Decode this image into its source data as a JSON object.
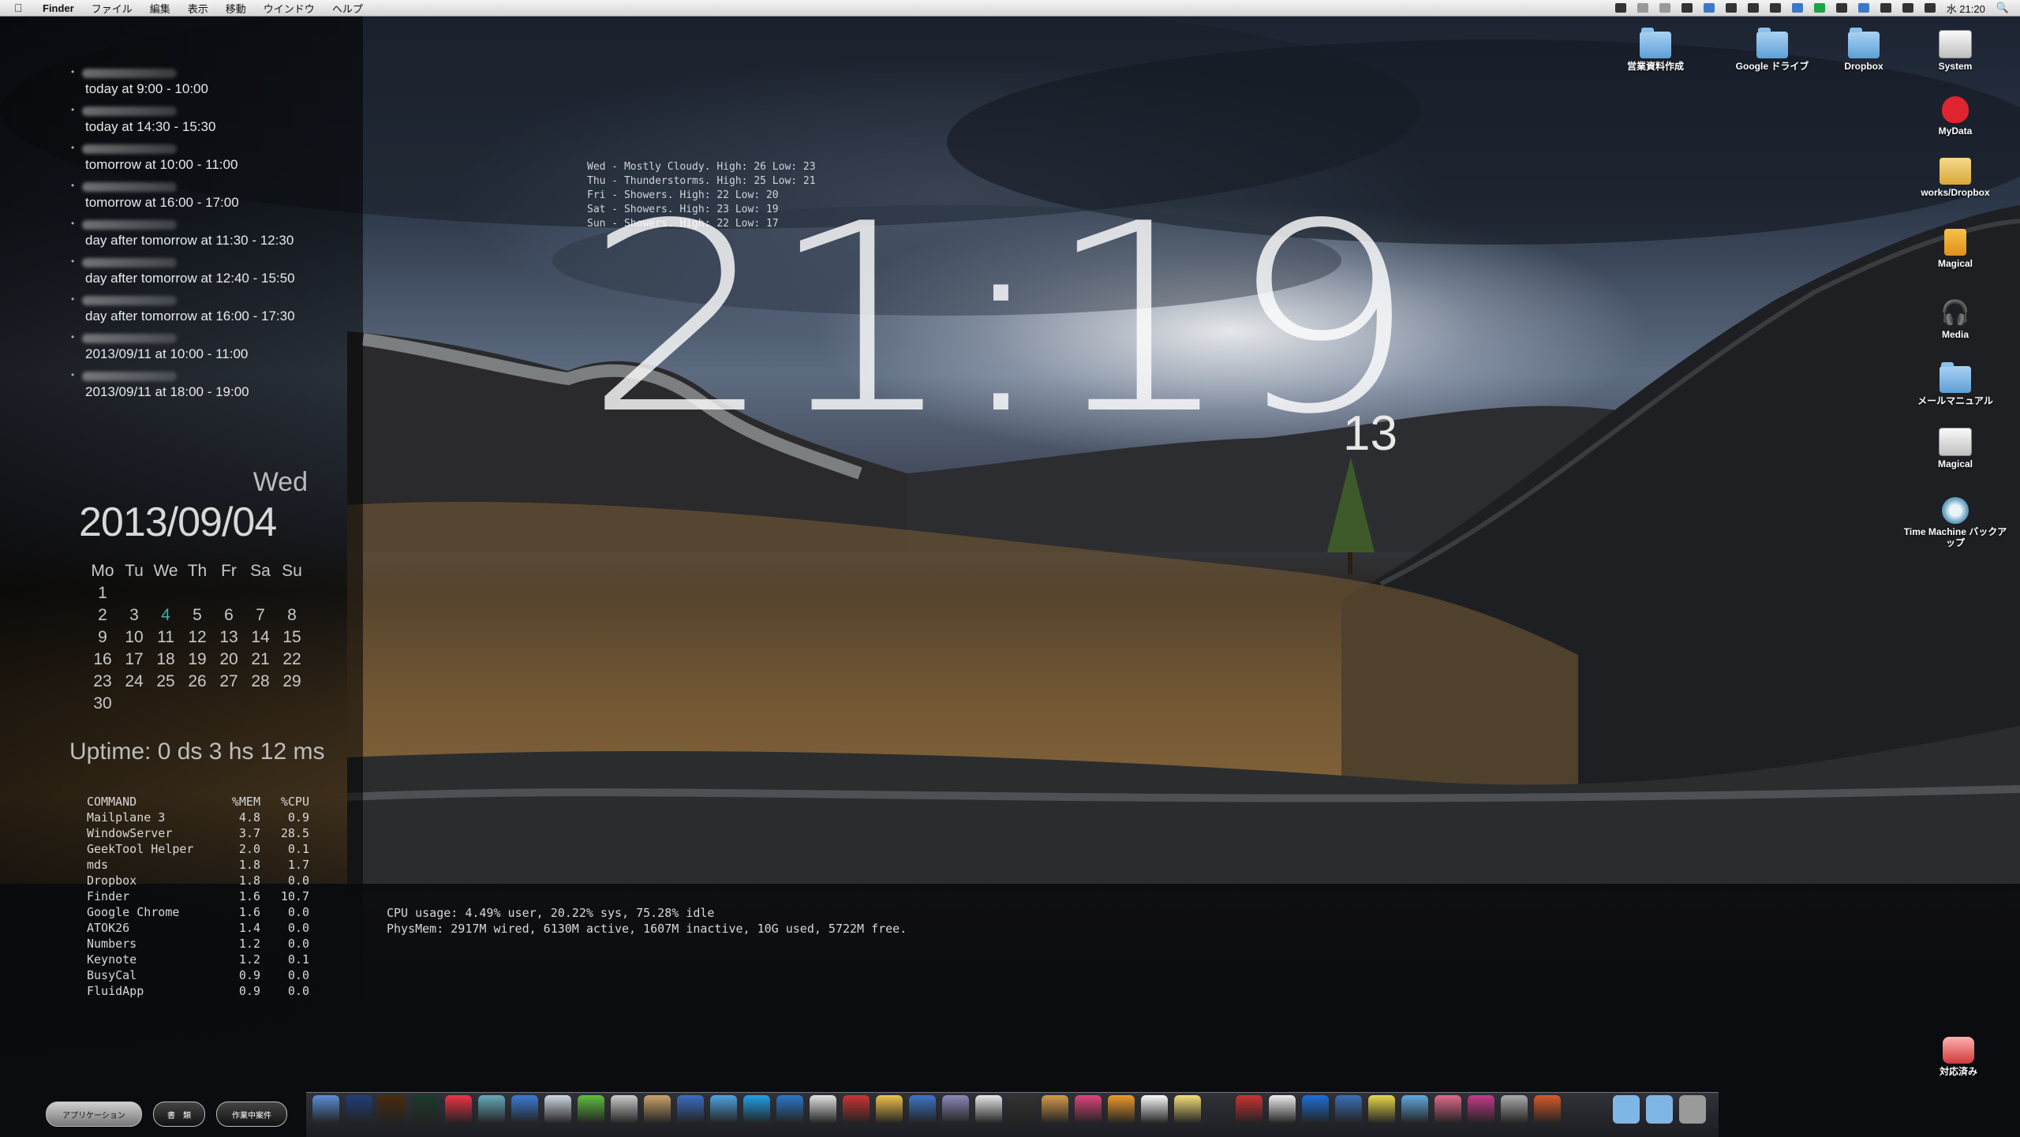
{
  "menubar": {
    "items": [
      "Finder",
      "ファイル",
      "編集",
      "表示",
      "移動",
      "ウインドウ",
      "ヘルプ"
    ],
    "time": "水 21:20"
  },
  "events": [
    {
      "time": "today at 9:00 - 10:00"
    },
    {
      "time": "today at 14:30 - 15:30"
    },
    {
      "time": "tomorrow at 10:00 - 11:00"
    },
    {
      "time": "tomorrow at 16:00 - 17:00"
    },
    {
      "time": "day after tomorrow at 11:30 - 12:30"
    },
    {
      "time": "day after tomorrow at 12:40 - 15:50"
    },
    {
      "time": "day after tomorrow at 16:00 - 17:30"
    },
    {
      "time": "2013/09/11 at 10:00 - 11:00"
    },
    {
      "time": "2013/09/11 at 18:00 - 19:00"
    }
  ],
  "date": {
    "weekday": "Wed",
    "full": "2013/09/04"
  },
  "calendar": {
    "header": [
      "Mo",
      "Tu",
      "We",
      "Th",
      "Fr",
      "Sa",
      "Su"
    ],
    "weeks": [
      [
        "1",
        "",
        "",
        "",
        "",
        "",
        ""
      ],
      [
        "2",
        "3",
        "4",
        "5",
        "6",
        "7",
        "8"
      ],
      [
        "9",
        "10",
        "11",
        "12",
        "13",
        "14",
        "15"
      ],
      [
        "16",
        "17",
        "18",
        "19",
        "20",
        "21",
        "22"
      ],
      [
        "23",
        "24",
        "25",
        "26",
        "27",
        "28",
        "29"
      ],
      [
        "30",
        "",
        "",
        "",
        "",
        "",
        ""
      ]
    ],
    "today": "4"
  },
  "uptime": "Uptime: 0 ds 3 hs 12 ms",
  "processes": {
    "header": {
      "name": "COMMAND",
      "mem": "%MEM",
      "cpu": "%CPU"
    },
    "rows": [
      {
        "name": "Mailplane 3",
        "mem": "4.8",
        "cpu": "0.9"
      },
      {
        "name": "WindowServer",
        "mem": "3.7",
        "cpu": "28.5"
      },
      {
        "name": "GeekTool Helper",
        "mem": "2.0",
        "cpu": "0.1"
      },
      {
        "name": "mds",
        "mem": "1.8",
        "cpu": "1.7"
      },
      {
        "name": "Dropbox",
        "mem": "1.8",
        "cpu": "0.0"
      },
      {
        "name": "Finder",
        "mem": "1.6",
        "cpu": "10.7"
      },
      {
        "name": "Google Chrome",
        "mem": "1.6",
        "cpu": "0.0"
      },
      {
        "name": "ATOK26",
        "mem": "1.4",
        "cpu": "0.0"
      },
      {
        "name": "Numbers",
        "mem": "1.2",
        "cpu": "0.0"
      },
      {
        "name": "Keynote",
        "mem": "1.2",
        "cpu": "0.1"
      },
      {
        "name": "BusyCal",
        "mem": "0.9",
        "cpu": "0.0"
      },
      {
        "name": "FluidApp",
        "mem": "0.9",
        "cpu": "0.0"
      }
    ]
  },
  "weather": [
    "Wed - Mostly Cloudy. High: 26 Low: 23",
    "Thu - Thunderstorms. High: 25 Low: 21",
    "Fri - Showers. High: 22 Low: 20",
    "Sat - Showers. High: 23 Low: 19",
    "Sun - Showers. High: 22 Low: 17"
  ],
  "clock": {
    "hm": "21:19",
    "seconds": "13"
  },
  "cpu": {
    "usage": "CPU usage: 4.49% user, 20.22% sys, 75.28% idle",
    "physmem": "PhysMem: 2917M wired, 6130M active, 1607M inactive, 10G used, 5722M free."
  },
  "desktop_icons": [
    {
      "label": "営業資料作成",
      "icon": "folder-icon"
    },
    {
      "label": "Google ドライブ",
      "icon": "folder-icon"
    },
    {
      "label": "Dropbox",
      "icon": "folder-icon"
    },
    {
      "label": "System",
      "icon": "drive-icon"
    },
    {
      "label": "MyData",
      "icon": "heart-drive-icon"
    },
    {
      "label": "works/Dropbox",
      "icon": "folder-icon"
    },
    {
      "label": "Magical",
      "icon": "usb-drive-icon"
    },
    {
      "label": "Media",
      "icon": "headphones-icon"
    },
    {
      "label": "メールマニュアル",
      "icon": "folder-icon"
    },
    {
      "label": "Magical",
      "icon": "drive-icon"
    },
    {
      "label": "Time Machine バックアップ",
      "icon": "time-machine-icon"
    },
    {
      "label": "対応済み",
      "icon": "red-folder-icon"
    }
  ],
  "dock": {
    "stacks": [
      "アプリケーション",
      "書　類",
      "作業中案件"
    ],
    "apps": [
      "Finder",
      "Photoshop",
      "Illustrator",
      "Dreamweaver",
      "Chrome",
      "Mail",
      "Xcode",
      "Rocket",
      "Evernote",
      "Scissors",
      "Box",
      "Guitar",
      "iTunes",
      "Skype",
      "Screens",
      "Calendar",
      "Gun",
      "Notes",
      "Keynote",
      "Paint",
      "Desktop",
      "Aperture",
      "Box2",
      "Heart",
      "Pages",
      "TextEdit",
      "Stickies"
    ],
    "date_icon": "4"
  },
  "colors": {
    "accent_today": "#3fb0a0"
  }
}
